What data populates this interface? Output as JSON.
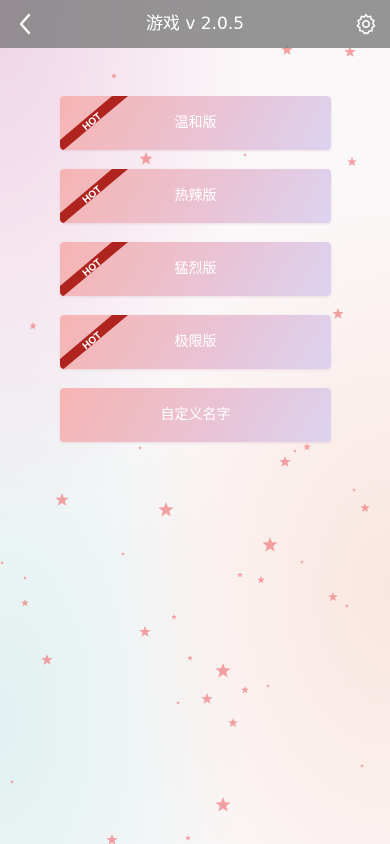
{
  "header": {
    "title": "游戏 v 2.0.5",
    "back_icon": "chevron-left-icon",
    "settings_icon": "gear-icon"
  },
  "menu": {
    "items": [
      {
        "label": "温和版",
        "badge": "HOT"
      },
      {
        "label": "热辣版",
        "badge": "HOT"
      },
      {
        "label": "猛烈版",
        "badge": "HOT"
      },
      {
        "label": "极限版",
        "badge": "HOT"
      },
      {
        "label": "自定义名字",
        "badge": ""
      }
    ]
  },
  "colors": {
    "header_bg": "#7a7a7a",
    "ribbon": "#b0241f",
    "star": "#f08a8c",
    "button_start": "#f6b4b2",
    "button_end": "#dcd3f0"
  }
}
